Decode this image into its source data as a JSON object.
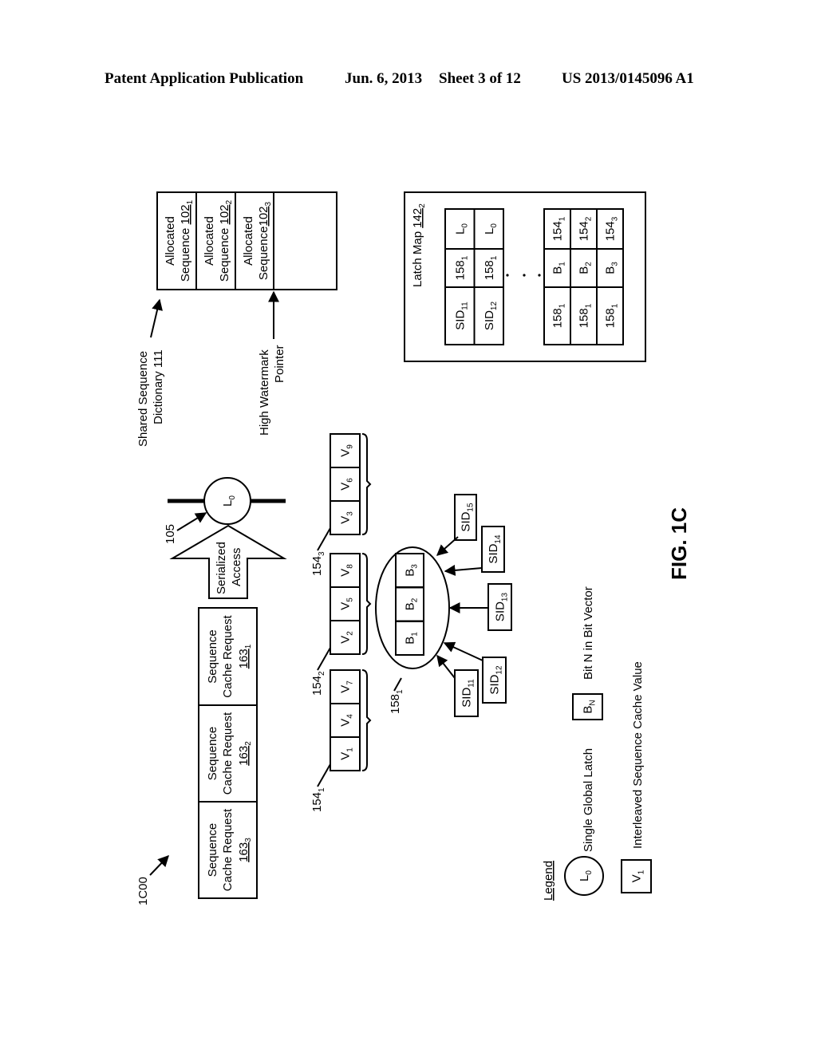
{
  "header": {
    "left": "Patent Application Publication",
    "date": "Jun. 6, 2013",
    "sheet": "Sheet 3 of 12",
    "number": "US 2013/0145096 A1"
  },
  "figure": {
    "id_label": "1C00",
    "caption": "FIG. 1C",
    "shared_dictionary": {
      "label_line1": "Shared Sequence",
      "label_line2": "Dictionary 111",
      "cells": [
        {
          "line1": "Allocated",
          "line2": "Sequence ",
          "ref": "102",
          "sub": "1"
        },
        {
          "line1": "Allocated",
          "line2": "Sequence ",
          "ref": "102",
          "sub": "2"
        },
        {
          "line1": "Allocated",
          "line2": "Sequence",
          "ref": "102",
          "sub": "3"
        }
      ],
      "pointer_line1": "High Watermark",
      "pointer_line2": "Pointer"
    },
    "latch_map": {
      "title": "Latch Map ",
      "ref": "142",
      "sub": "2",
      "upper_rows": [
        [
          {
            "t": "SID",
            "s": "11"
          },
          {
            "t": "158",
            "s": "1"
          },
          {
            "t": "L",
            "s": "0"
          }
        ],
        [
          {
            "t": "SID",
            "s": "12"
          },
          {
            "t": "158",
            "s": "1"
          },
          {
            "t": "L",
            "s": "0"
          }
        ]
      ],
      "ellipsis": ". . .",
      "lower_rows": [
        [
          {
            "t": "158",
            "s": "1"
          },
          {
            "t": "B",
            "s": "1"
          },
          {
            "t": "154",
            "s": "1"
          }
        ],
        [
          {
            "t": "158",
            "s": "1"
          },
          {
            "t": "B",
            "s": "2"
          },
          {
            "t": "154",
            "s": "2"
          }
        ],
        [
          {
            "t": "158",
            "s": "1"
          },
          {
            "t": "B",
            "s": "3"
          },
          {
            "t": "154",
            "s": "3"
          }
        ]
      ]
    },
    "requests": [
      {
        "line1": "Sequence",
        "line2": "Cache Request",
        "ref": "163",
        "sub": "1"
      },
      {
        "line1": "Sequence",
        "line2": "Cache Request",
        "ref": "163",
        "sub": "2"
      },
      {
        "line1": "Sequence",
        "line2": "Cache Request",
        "ref": "163",
        "sub": "3"
      }
    ],
    "serialized_access": {
      "line1": "Serialized",
      "line2": "Access"
    },
    "latch": {
      "ref": "105",
      "t": "L",
      "s": "0"
    },
    "vectors": [
      {
        "ref": "154",
        "sub": "1",
        "cells": [
          {
            "t": "V",
            "s": "1"
          },
          {
            "t": "V",
            "s": "4"
          },
          {
            "t": "V",
            "s": "7"
          }
        ]
      },
      {
        "ref": "154",
        "sub": "2",
        "cells": [
          {
            "t": "V",
            "s": "2"
          },
          {
            "t": "V",
            "s": "5"
          },
          {
            "t": "V",
            "s": "8"
          }
        ]
      },
      {
        "ref": "154",
        "sub": "3",
        "cells": [
          {
            "t": "V",
            "s": "3"
          },
          {
            "t": "V",
            "s": "6"
          },
          {
            "t": "V",
            "s": "9"
          }
        ]
      }
    ],
    "bit_vector": {
      "ref": "158",
      "sub": "1",
      "cells": [
        {
          "t": "B",
          "s": "1"
        },
        {
          "t": "B",
          "s": "2"
        },
        {
          "t": "B",
          "s": "3"
        }
      ]
    },
    "sids": [
      {
        "t": "SID",
        "s": "11"
      },
      {
        "t": "SID",
        "s": "12"
      },
      {
        "t": "SID",
        "s": "13"
      },
      {
        "t": "SID",
        "s": "14"
      },
      {
        "t": "SID",
        "s": "15"
      }
    ],
    "legend": {
      "title": "Legend",
      "items": [
        {
          "symbol_t": "L",
          "symbol_s": "0",
          "label": "Single Global Latch"
        },
        {
          "symbol_t": "B",
          "symbol_s": "N",
          "label": "Bit N in Bit Vector"
        },
        {
          "symbol_t": "V",
          "symbol_s": "1",
          "label": "Interleaved Sequence Cache Value"
        }
      ]
    }
  }
}
